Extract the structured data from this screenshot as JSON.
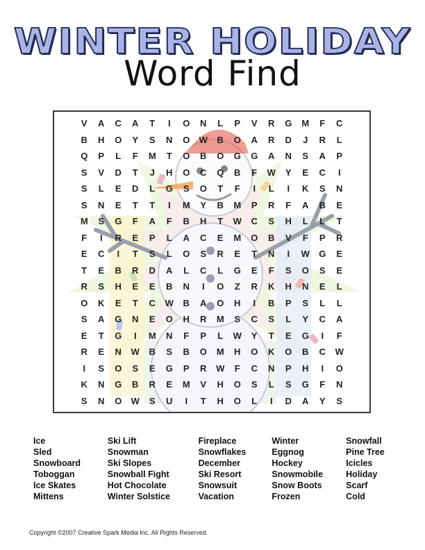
{
  "header": {
    "title": "WINTER HOLIDAY",
    "subtitle": "Word Find"
  },
  "grid": [
    [
      "V",
      "A",
      "C",
      "A",
      "T",
      "I",
      "O",
      "N",
      "L",
      "P",
      "V",
      "R",
      "G",
      "M",
      "F",
      "C",
      "",
      ""
    ],
    [
      "B",
      "H",
      "O",
      "Y",
      "S",
      "N",
      "O",
      "W",
      "B",
      "O",
      "A",
      "R",
      "D",
      "J",
      "R",
      "L",
      "",
      ""
    ],
    [
      "Q",
      "P",
      "L",
      "F",
      "M",
      "T",
      "O",
      "B",
      "O",
      "G",
      "G",
      "A",
      "N",
      "S",
      "A",
      "P",
      "",
      ""
    ],
    [
      "S",
      "V",
      "D",
      "T",
      "J",
      "H",
      "O",
      "C",
      "Q",
      "B",
      "F",
      "W",
      "Y",
      "E",
      "C",
      "I",
      "",
      ""
    ],
    [
      "S",
      "L",
      "E",
      "D",
      "L",
      "G",
      "S",
      "O",
      "T",
      "F",
      "I",
      "L",
      "I",
      "K",
      "S",
      "N",
      "",
      ""
    ],
    [
      "S",
      "N",
      "E",
      "T",
      "T",
      "I",
      "M",
      "Y",
      "B",
      "M",
      "P",
      "R",
      "F",
      "A",
      "B",
      "E",
      "",
      ""
    ],
    [
      "M",
      "S",
      "G",
      "F",
      "A",
      "F",
      "B",
      "H",
      "T",
      "W",
      "C",
      "S",
      "H",
      "L",
      "L",
      "T",
      "",
      ""
    ],
    [
      "F",
      "I",
      "R",
      "E",
      "P",
      "L",
      "A",
      "C",
      "E",
      "M",
      "O",
      "B",
      "V",
      "F",
      "P",
      "R",
      "",
      ""
    ],
    [
      "E",
      "C",
      "I",
      "T",
      "S",
      "L",
      "O",
      "S",
      "R",
      "E",
      "T",
      "N",
      "I",
      "W",
      "G",
      "E",
      "",
      ""
    ],
    [
      "T",
      "E",
      "B",
      "R",
      "D",
      "A",
      "L",
      "C",
      "L",
      "G",
      "E",
      "F",
      "S",
      "O",
      "S",
      "E",
      "",
      ""
    ],
    [
      "R",
      "S",
      "H",
      "E",
      "E",
      "B",
      "N",
      "I",
      "O",
      "Z",
      "R",
      "K",
      "H",
      "N",
      "E",
      "L",
      "",
      ""
    ],
    [
      "O",
      "K",
      "E",
      "T",
      "C",
      "W",
      "B",
      "A",
      "O",
      "H",
      "I",
      "B",
      "P",
      "S",
      "L",
      "L",
      "",
      ""
    ],
    [
      "S",
      "A",
      "G",
      "N",
      "E",
      "O",
      "H",
      "R",
      "M",
      "S",
      "C",
      "S",
      "L",
      "Y",
      "C",
      "A",
      "",
      ""
    ],
    [
      "E",
      "T",
      "G",
      "I",
      "M",
      "N",
      "F",
      "P",
      "L",
      "W",
      "Y",
      "T",
      "E",
      "G",
      "I",
      "F",
      "",
      ""
    ],
    [
      "R",
      "E",
      "N",
      "W",
      "B",
      "S",
      "B",
      "O",
      "M",
      "H",
      "O",
      "K",
      "O",
      "B",
      "C",
      "W",
      "",
      ""
    ],
    [
      "I",
      "S",
      "O",
      "S",
      "E",
      "G",
      "P",
      "R",
      "W",
      "F",
      "C",
      "N",
      "P",
      "H",
      "I",
      "O",
      "",
      ""
    ],
    [
      "K",
      "N",
      "G",
      "B",
      "R",
      "E",
      "M",
      "V",
      "H",
      "O",
      "S",
      "L",
      "S",
      "G",
      "F",
      "N",
      "",
      ""
    ],
    [
      "S",
      "N",
      "O",
      "W",
      "S",
      "U",
      "I",
      "T",
      "H",
      "O",
      "L",
      "I",
      "D",
      "A",
      "Y",
      "S",
      "",
      ""
    ]
  ],
  "word_columns": [
    [
      "Ice",
      "Sled",
      "Snowboard",
      "Toboggan",
      "Ice Skates",
      "Mittens"
    ],
    [
      "Ski Lift",
      "Snowman",
      "Ski Slopes",
      "Snowball Fight",
      "Hot Chocolate",
      "Winter Solstice"
    ],
    [
      "Fireplace",
      "Snowflakes",
      "December",
      "Ski Resort",
      "Snowsuit",
      "Vacation"
    ],
    [
      "Winter",
      "Eggnog",
      "Hockey",
      "Snowmobile",
      "Snow Boots",
      "Frozen"
    ],
    [
      "Snowfall",
      "Pine Tree",
      "Icicles",
      "Holiday",
      "Scarf",
      "Cold"
    ]
  ],
  "copyright": "Copyright ©2007   Creative Spark Media Inc.  All Rights Reserved.",
  "colors": {
    "title_fill": "#a9b3e6",
    "title_outline": "#1f2a55",
    "grid_border": "#3a3a3a",
    "hat_red": "#e04a3c",
    "rays": [
      "#f3f6c8",
      "#d6ecd2",
      "#f7dede",
      "#dde3f5"
    ]
  }
}
